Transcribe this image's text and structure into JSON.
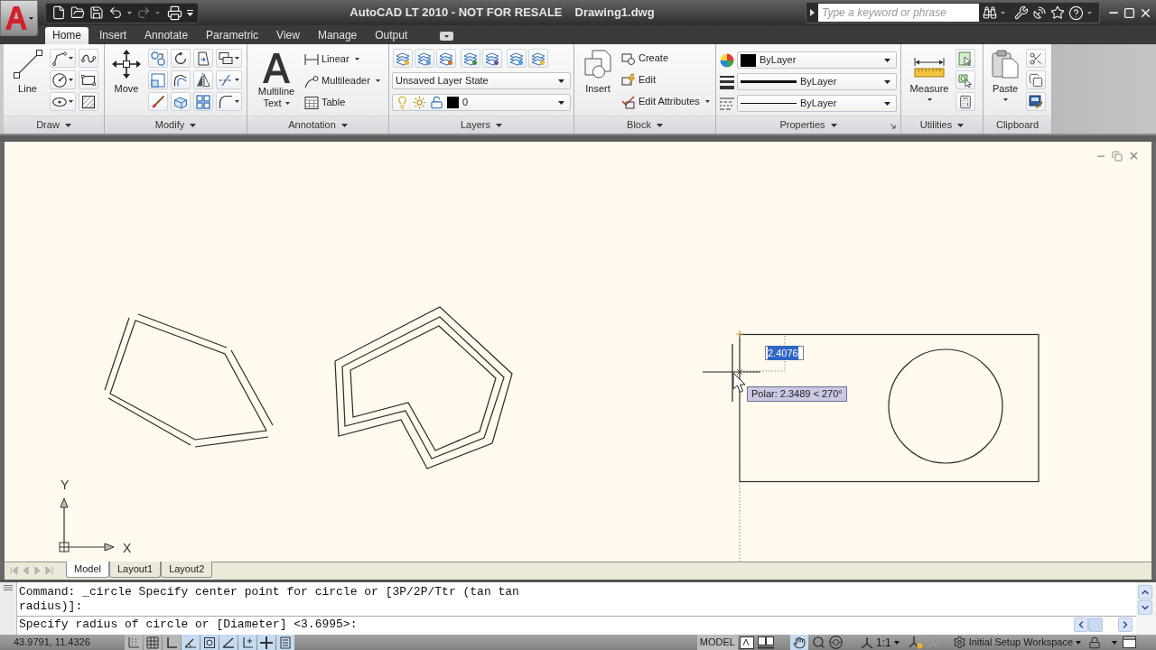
{
  "window": {
    "title": "AutoCAD LT 2010 - NOT FOR RESALE",
    "file_name": "Drawing1.dwg"
  },
  "search": {
    "placeholder": "Type a keyword or phrase"
  },
  "ribbon_tabs": [
    {
      "label": "Home",
      "selected": true
    },
    {
      "label": "Insert",
      "selected": false
    },
    {
      "label": "Annotate",
      "selected": false
    },
    {
      "label": "Parametric",
      "selected": false
    },
    {
      "label": "View",
      "selected": false
    },
    {
      "label": "Manage",
      "selected": false
    },
    {
      "label": "Output",
      "selected": false
    }
  ],
  "panels": [
    {
      "kind": "draw",
      "title": "Draw",
      "menu": true,
      "large_button": {
        "label": "Line",
        "menu": false
      }
    },
    {
      "kind": "modify",
      "title": "Modify",
      "menu": true,
      "large_button": {
        "label": "Move",
        "menu": false
      }
    },
    {
      "kind": "annotation",
      "title": "Annotation",
      "menu": true,
      "large_button": {
        "label": "Multiline Text",
        "menu": true
      },
      "items": [
        {
          "label": "Linear",
          "menu": true
        },
        {
          "label": "Multileader",
          "menu": true
        },
        {
          "label": "Table",
          "menu": false
        }
      ]
    },
    {
      "kind": "layers",
      "title": "Layers",
      "menu": true,
      "layer_state": "Unsaved Layer State",
      "current_layer": "0"
    },
    {
      "kind": "block",
      "title": "Block",
      "menu": true,
      "large_button": {
        "label": "Insert",
        "menu": false
      },
      "items": [
        {
          "label": "Create",
          "menu": false
        },
        {
          "label": "Edit",
          "menu": false
        },
        {
          "label": "Edit Attributes",
          "menu": true
        }
      ]
    },
    {
      "kind": "properties",
      "title": "Properties",
      "menu": true,
      "dialog_launcher": true,
      "current_color": "ByLayer",
      "current_lineweight": "ByLayer",
      "current_linetype": "ByLayer"
    },
    {
      "kind": "utilities",
      "title": "Utilities",
      "menu": true,
      "large_button": {
        "label": "Measure",
        "menu": true
      }
    },
    {
      "kind": "clipboard",
      "title": "Clipboard",
      "menu": false,
      "large_button": {
        "label": "Paste",
        "menu": true
      }
    }
  ],
  "viewport": {
    "dynamic_input": {
      "value": "2.4076",
      "selected": true
    },
    "tooltip": "Polar: 2.3489 < 270°",
    "ucs": {
      "x_label": "X",
      "y_label": "Y"
    }
  },
  "layout_tabs": [
    {
      "label": "Model",
      "selected": true
    },
    {
      "label": "Layout1",
      "selected": false
    },
    {
      "label": "Layout2",
      "selected": false
    }
  ],
  "command_line": {
    "history": "Command: _circle Specify center point for circle or [3P/2P/Ttr (tan tan radius)]:",
    "prompt": "Specify radius of circle or [Diameter] <3.6995>:"
  },
  "status_bar": {
    "coordinates": "43.9791, 11.4326",
    "toggles": [
      {
        "on": false
      },
      {
        "on": false
      },
      {
        "on": false
      },
      {
        "on": true
      },
      {
        "on": true
      },
      {
        "on": true
      },
      {
        "on": true
      },
      {
        "on": true
      },
      {
        "on": true
      }
    ],
    "space": "MODEL",
    "annotation_scale": "1:1",
    "workspace": "Initial Setup Workspace"
  }
}
